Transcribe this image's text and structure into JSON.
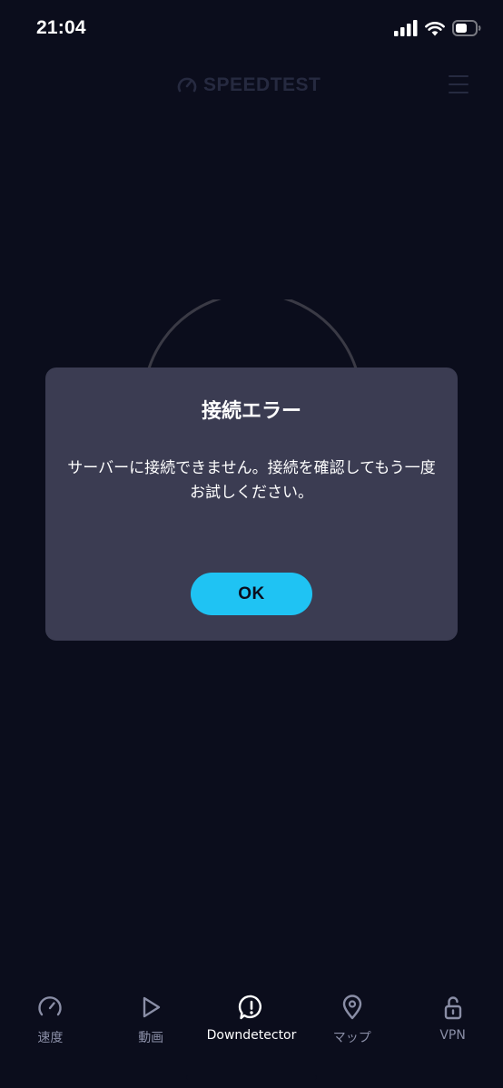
{
  "status_bar": {
    "time": "21:04"
  },
  "header": {
    "logo_text": "SPEEDTEST"
  },
  "dialog": {
    "title": "接続エラー",
    "message": "サーバーに接続できません。接続を確認してもう一度お試しください。",
    "ok_label": "OK"
  },
  "tabs": [
    {
      "label": "速度",
      "icon": "speedometer-icon",
      "active": false
    },
    {
      "label": "動画",
      "icon": "play-icon",
      "active": false
    },
    {
      "label": "Downdetector",
      "icon": "alert-icon",
      "active": true
    },
    {
      "label": "マップ",
      "icon": "map-pin-icon",
      "active": false
    },
    {
      "label": "VPN",
      "icon": "lock-icon",
      "active": false
    }
  ],
  "colors": {
    "background": "#0b0d1c",
    "dialog_background": "#3b3c52",
    "accent": "#1fc3f3",
    "inactive_tab": "#8a8ea6"
  }
}
